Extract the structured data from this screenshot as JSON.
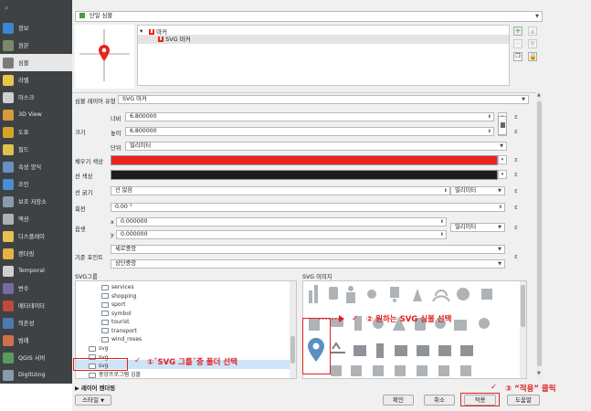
{
  "sidebar": {
    "search_icon": "search-icon",
    "items": [
      {
        "label": "정보",
        "icon": "info-icon",
        "color": "#3a86d0"
      },
      {
        "label": "원본",
        "icon": "source-icon",
        "color": "#7b8a6a"
      },
      {
        "label": "심볼",
        "icon": "symbology-icon",
        "color": "#7b7b7b"
      },
      {
        "label": "라벨",
        "icon": "label-icon",
        "color": "#e8c64a"
      },
      {
        "label": "마스크",
        "icon": "mask-icon",
        "color": "#cfcfcf"
      },
      {
        "label": "3D View",
        "icon": "cube-3d-icon",
        "color": "#d89b3a"
      },
      {
        "label": "도표",
        "icon": "diagram-icon",
        "color": "#d9a32a"
      },
      {
        "label": "필드",
        "icon": "fields-icon",
        "color": "#e0c050"
      },
      {
        "label": "속성 양식",
        "icon": "attributes-form-icon",
        "color": "#6a8fc0"
      },
      {
        "label": "조인",
        "icon": "join-icon",
        "color": "#4a8fd0"
      },
      {
        "label": "보조 저장소",
        "icon": "auxiliary-storage-icon",
        "color": "#8a9aa8"
      },
      {
        "label": "액션",
        "icon": "action-gear-icon",
        "color": "#b0b0b0"
      },
      {
        "label": "디스플레이",
        "icon": "display-tip-icon",
        "color": "#e8c050"
      },
      {
        "label": "렌더링",
        "icon": "rendering-brush-icon",
        "color": "#e8b040"
      },
      {
        "label": "Temporal",
        "icon": "clock-icon",
        "color": "#cfcfcf"
      },
      {
        "label": "변수",
        "icon": "variables-icon",
        "color": "#7a6aa0"
      },
      {
        "label": "메타데이터",
        "icon": "metadata-icon",
        "color": "#c04a3a"
      },
      {
        "label": "의존성",
        "icon": "dependencies-icon",
        "color": "#4a7ab0"
      },
      {
        "label": "범례",
        "icon": "legend-icon",
        "color": "#d0704a"
      },
      {
        "label": "QGIS 서버",
        "icon": "server-icon",
        "color": "#5a9a5a"
      },
      {
        "label": "Digitizing",
        "icon": "digitizing-icon",
        "color": "#8a9aa8"
      }
    ]
  },
  "top": {
    "renderer_label": "단일 심볼",
    "renderer_icon": "single-symbol-icon"
  },
  "symbol_tree": {
    "items": [
      {
        "label": "마커",
        "icon": "marker-icon"
      },
      {
        "label": "SVG 마커",
        "icon": "svg-marker-icon"
      }
    ],
    "side_buttons": [
      "add-layer-icon",
      "remove-layer-icon",
      "move-up-icon",
      "move-down-icon",
      "duplicate-icon",
      "lock-icon"
    ]
  },
  "layer_type": {
    "label": "심볼 레이어 유형",
    "value": "SVG 마커"
  },
  "size": {
    "label": "크기",
    "width_label": "너비",
    "width_value": "6.800000",
    "height_label": "높이",
    "height_value": "6.800000",
    "unit_label": "단위",
    "unit_value": "밀리미터"
  },
  "fill_color": {
    "label": "채우기 색상",
    "color": "#e8241c"
  },
  "stroke_color": {
    "label": "선 색상",
    "color": "#1c1c1c"
  },
  "stroke_width": {
    "label": "선 굵기",
    "value": "선 없음",
    "unit": "밀리미터"
  },
  "rotation": {
    "label": "회전",
    "value": "0.00 °"
  },
  "offset": {
    "label": "옵셋",
    "x_label": "x",
    "x_value": "0.000000",
    "y_label": "y",
    "y_value": "0.000000",
    "unit": "밀리미터"
  },
  "anchor": {
    "label": "기준 포인트",
    "horizontal": "세로중앙",
    "vertical": "상단중앙"
  },
  "svg_groups": {
    "title": "SVG그룹",
    "folders": [
      "services",
      "shopping",
      "sport",
      "symbol",
      "tourist",
      "transport",
      "wind_roses"
    ],
    "root_folders": [
      "svg",
      "svg",
      "svg"
    ],
    "bottom_item": "중앙프로그램 심볼"
  },
  "svg_images": {
    "title": "SVG 이미지"
  },
  "layer_rendering": {
    "label": "레이어 렌더링"
  },
  "buttons": {
    "style": "스타일",
    "ok": "확인",
    "cancel": "취소",
    "apply": "적용",
    "help": "도움말"
  },
  "annotations": {
    "step1": "①ˇSVG 그룹ˇ중 폴더 선택",
    "step2": "② 원하는 SVG 심볼 선택",
    "step3": "③ “적용” 클릭",
    "check": "✓",
    "color": "#e02020"
  }
}
